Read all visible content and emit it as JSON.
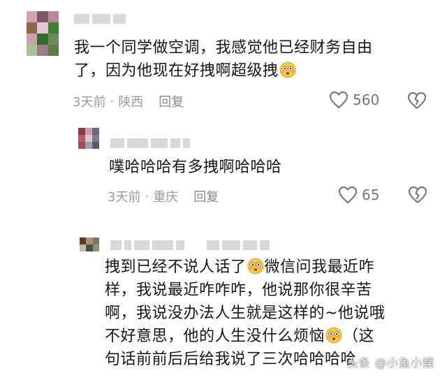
{
  "comments": [
    {
      "text_lines": [
        "我一个同学做空调，我感觉他已经财务自由",
        "了，因为他现在好拽啊超级拽"
      ],
      "time": "3天前",
      "location": "陕西",
      "reply_label": "回复",
      "likes": "560",
      "avatar_colors": [
        "#cfa5b5",
        "#7a5a66",
        "#b48a9a",
        "#8a6a4a",
        "#e3c6d0",
        "#3f7d3a",
        "#c9a0ae",
        "#2f6b2b",
        "#6b8b5a",
        "#aac59a",
        "#9e7a86",
        "#5b7f4a"
      ]
    },
    {
      "text_lines": [
        "噗哈哈哈有多拽啊哈哈哈"
      ],
      "time": "3天前",
      "location": "重庆",
      "reply_label": "回复",
      "likes": "65",
      "avatar_colors": [
        "#8a3a4a",
        "#c9a1ad",
        "#6a6a7a",
        "#b35a6a",
        "#d9c6cc",
        "#7c7c8c",
        "#a14a5a",
        "#9aa0b4",
        "#5a5a6a"
      ]
    },
    {
      "text_lines": [
        "拽到已经不说人话了",
        "微信问我最近咋",
        "样，我说最近咋咋咋，他说那你很辛苦",
        "啊，我说没办法人生就是这样的~他说哦",
        "不好意思，他的人生没什么烦恼",
        "（这",
        "句话前前后后给我说了三次哈哈哈哈"
      ],
      "avatar_colors": [
        "#5a3a2a",
        "#b28a7a",
        "#7a7a6a",
        "#c8b6a8",
        "#3a5a3a",
        "#9a8a7a"
      ]
    }
  ],
  "watermark": "头条 @小鱼小娱",
  "colors": {
    "meta_gray": "#9b9b9b",
    "placeholder_gray": "#d9d9d9"
  },
  "icons": [
    "thumbs-up-outline-icon",
    "broken-heart-icon",
    "flushed-face-emoji"
  ]
}
